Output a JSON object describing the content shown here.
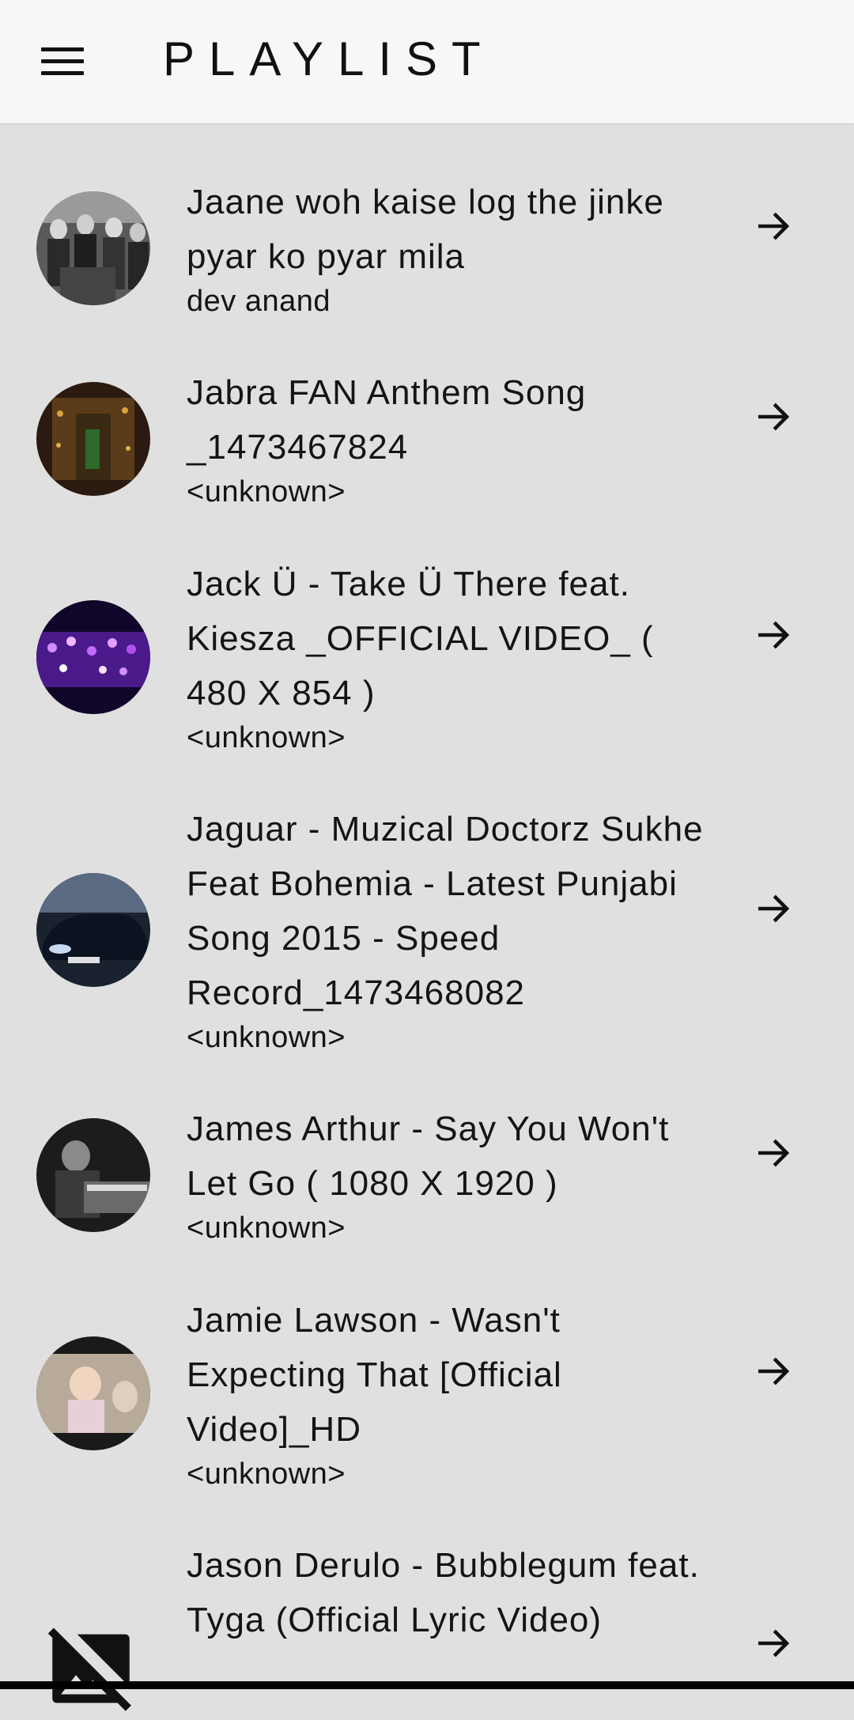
{
  "app": {
    "title": "PLAYLIST",
    "menu_icon": "hamburger-menu-icon"
  },
  "playlist": [
    {
      "title": "Jaane woh kaise log the jinke pyar ko pyar mila",
      "artist": "dev anand",
      "thumb": "bw-group"
    },
    {
      "title": "Jabra FAN Anthem Song _1473467824",
      "artist": "<unknown>",
      "thumb": "dark-stage"
    },
    {
      "title": "Jack Ü - Take Ü There feat. Kiesza _OFFICIAL VIDEO_ ( 480 X 854 )",
      "artist": "<unknown>",
      "thumb": "purple-crowd"
    },
    {
      "title": "Jaguar - Muzical Doctorz Sukhe Feat Bohemia - Latest Punjabi Song 2015 - Speed Record_1473468082",
      "artist": "<unknown>",
      "thumb": "car"
    },
    {
      "title": "James Arthur - Say You Won't Let Go ( 1080 X 1920 )",
      "artist": "<unknown>",
      "thumb": "bw-piano"
    },
    {
      "title": "Jamie Lawson - Wasn't Expecting That [Official Video]_HD",
      "artist": "<unknown>",
      "thumb": "baby"
    },
    {
      "title": "Jason Derulo - Bubblegum feat. Tyga (Official Lyric Video)",
      "artist": "",
      "thumb": "no-image-icon"
    }
  ]
}
